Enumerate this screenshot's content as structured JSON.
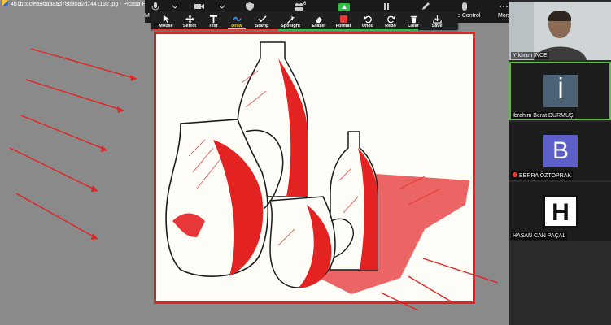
{
  "window": {
    "title": "4b1bcccfea9daa8ad78da0a2d7441192.jpg - Picasa Fo"
  },
  "zoom_toolbar": {
    "left_label": "M",
    "chat_count": "6",
    "remote_control_label": "e Control",
    "more_label": "More"
  },
  "annotation_tools": [
    {
      "id": "mouse",
      "label": "Mouse",
      "icon": "mouse-pointer-icon"
    },
    {
      "id": "select",
      "label": "Select",
      "icon": "move-arrows-icon"
    },
    {
      "id": "text",
      "label": "Text",
      "icon": "text-icon"
    },
    {
      "id": "draw",
      "label": "Draw",
      "icon": "squiggle-icon",
      "active": true
    },
    {
      "id": "stamp",
      "label": "Stamp",
      "icon": "checkmark-icon"
    },
    {
      "id": "spotlight",
      "label": "Spotlight",
      "icon": "spotlight-icon"
    },
    {
      "id": "eraser",
      "label": "Eraser",
      "icon": "eraser-icon"
    },
    {
      "id": "format",
      "label": "Format",
      "icon": "color-swatch-icon",
      "color": "#e53935"
    },
    {
      "id": "undo",
      "label": "Undo",
      "icon": "undo-icon"
    },
    {
      "id": "redo",
      "label": "Redo",
      "icon": "redo-icon"
    },
    {
      "id": "clear",
      "label": "Clear",
      "icon": "trash-icon"
    },
    {
      "id": "save",
      "label": "Save",
      "icon": "save-icon"
    }
  ],
  "annotation_color": "#e32222",
  "participants": [
    {
      "name": "Yıldırım İNCE",
      "type": "video"
    },
    {
      "name": "İbrahim Berat DURMUŞ",
      "type": "avatar",
      "initial": "İ",
      "bg": "#4a6274",
      "active": true
    },
    {
      "name": "BERRA ÖZTOPRAK",
      "type": "avatar",
      "initial": "B",
      "bg": "#5b5fc7",
      "muted": true
    },
    {
      "name": "HASAN CAN PAÇAL",
      "type": "avatar",
      "initial": "H",
      "bg": "#ffffff"
    }
  ]
}
